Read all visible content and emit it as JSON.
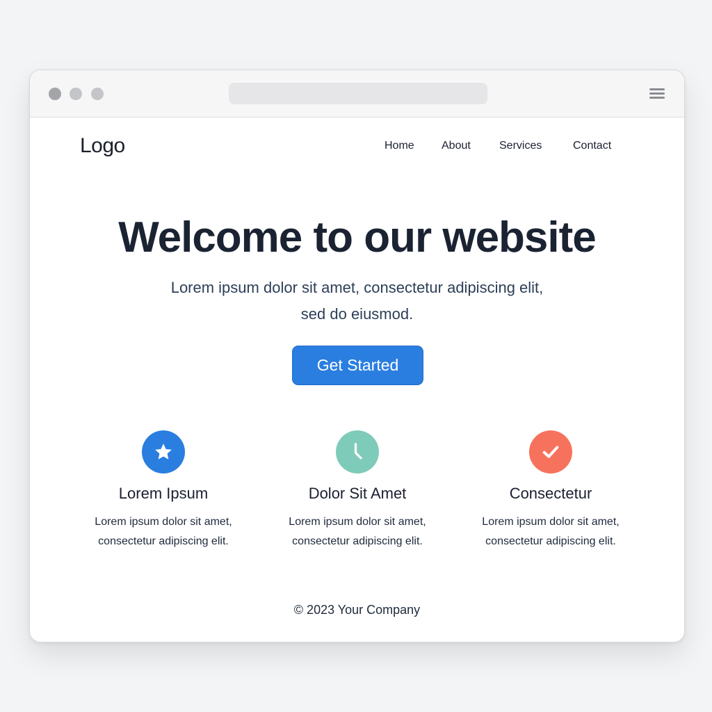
{
  "browser": {
    "address_bar": "",
    "colors": {
      "dot_dark": "#a3a5a9",
      "dot_light": "#c3c5c8"
    }
  },
  "header": {
    "logo": "Logo",
    "nav": [
      "Home",
      "About",
      "Services",
      "Contact"
    ]
  },
  "hero": {
    "title": "Welcome to our website",
    "subtitle_line1": "Lorem ipsum dolor sit amet, consectetur adipiscing elit,",
    "subtitle_line2": "sed do eiusmod.",
    "cta_label": "Get Started",
    "cta_color": "#2a7ee0"
  },
  "features": [
    {
      "icon": "star-icon",
      "color": "#2a7ee0",
      "title": "Lorem Ipsum",
      "desc_line1": "Lorem ipsum dolor sit amet,",
      "desc_line2": "consectetur adipiscing elit."
    },
    {
      "icon": "clock-icon",
      "color": "#7fcbb9",
      "title": "Dolor Sit Amet",
      "desc_line1": "Lorem ipsum dolor sit amet,",
      "desc_line2": "consectetur adipiscing elit."
    },
    {
      "icon": "check-icon",
      "color": "#f7725c",
      "title": "Consectetur",
      "desc_line1": "Lorem ipsum dolor sit amet,",
      "desc_line2": "consectetur adipiscing elit."
    }
  ],
  "footer": {
    "text": "© 2023 Your Company"
  }
}
